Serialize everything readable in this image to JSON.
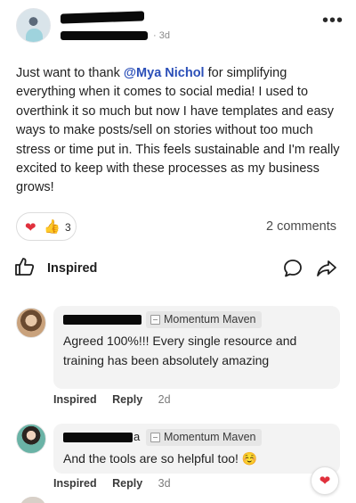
{
  "post": {
    "time": "· 3d",
    "more_icon": "•••",
    "body_before": "Just want to thank ",
    "mention": "@Mya Nichol",
    "body_after": " for simplifying everything when it comes to social media! I used to overthink it so much but now I have templates and easy ways to make posts/sell on stories without too much stress or time put in. This feels sustainable and I'm really excited to keep with these processes as my business grows!",
    "reactions": {
      "heart_icon": "❤",
      "thumbs_icon": "👍",
      "count": "3"
    },
    "comments_count": "2 comments",
    "actions": {
      "inspired_label": "Inspired"
    }
  },
  "comments": [
    {
      "badge": "Momentum Maven",
      "text": "Agreed 100%!!! Every single resource and training has been absolutely amazing",
      "inspired": "Inspired",
      "reply": "Reply",
      "time": "2d"
    },
    {
      "name_fragment": "a",
      "badge": "Momentum Maven",
      "text": "And the tools are so helpful too! ☺️",
      "inspired": "Inspired",
      "reply": "Reply",
      "time": "3d",
      "reaction_icon": "❤"
    }
  ],
  "colors": {
    "mention": "#2b4fb8",
    "heart": "#e0303c",
    "bubble": "#f3f3f3",
    "badge": "#e6e6e6"
  }
}
